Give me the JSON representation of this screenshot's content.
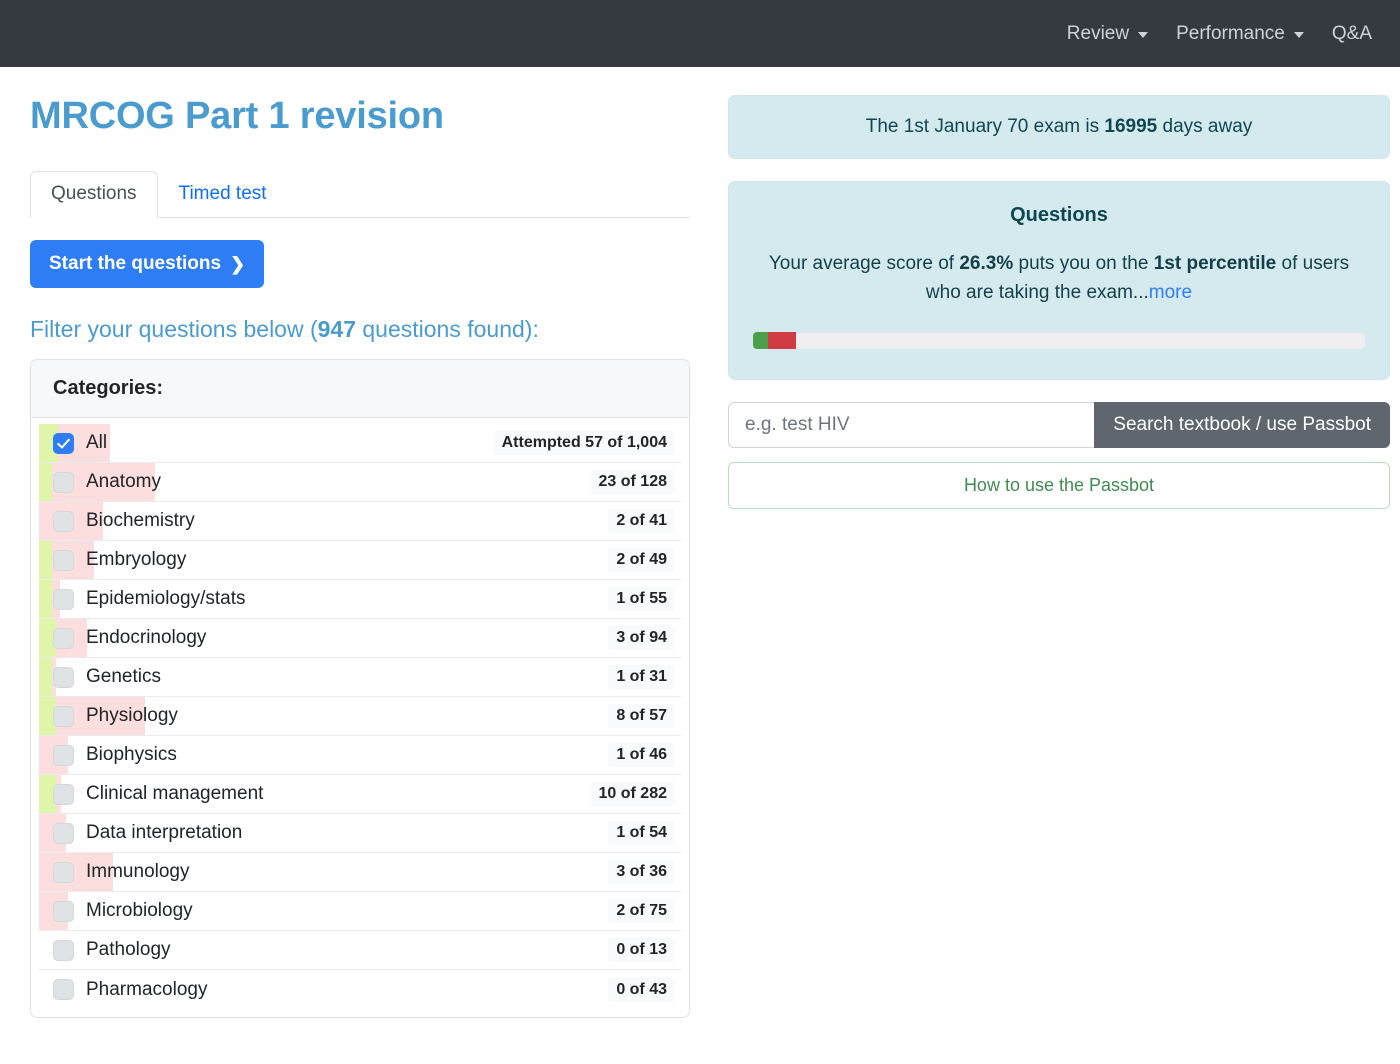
{
  "navbar": {
    "items": [
      {
        "label": "Review",
        "has_caret": true
      },
      {
        "label": "Performance",
        "has_caret": true
      },
      {
        "label": "Q&A",
        "has_caret": false
      }
    ]
  },
  "main": {
    "title": "MRCOG Part 1 revision",
    "tabs": [
      {
        "label": "Questions",
        "active": true
      },
      {
        "label": "Timed test",
        "active": false
      }
    ],
    "start_button": "Start the questions",
    "start_button_chevron": "❯",
    "filter_heading_prefix": "Filter your questions below (",
    "filter_heading_count": "947",
    "filter_heading_suffix": " questions found):",
    "categories_header": "Categories:",
    "categories": [
      {
        "label": "All",
        "count": "Attempted 57 of 1,004",
        "checked": true,
        "green_pct": 3,
        "red_pct": 11
      },
      {
        "label": "Anatomy",
        "count": "23 of 128",
        "checked": false,
        "green_pct": 2.1,
        "red_pct": 18
      },
      {
        "label": "Biochemistry",
        "count": "2 of 41",
        "checked": false,
        "green_pct": 0,
        "red_pct": 10
      },
      {
        "label": "Embryology",
        "count": "2 of 49",
        "checked": false,
        "green_pct": 2.1,
        "red_pct": 8.5
      },
      {
        "label": "Epidemiology/stats",
        "count": "1 of 55",
        "checked": false,
        "green_pct": 2.1,
        "red_pct": 3.2
      },
      {
        "label": "Endocrinology",
        "count": "3 of 94",
        "checked": false,
        "green_pct": 2.6,
        "red_pct": 7.5
      },
      {
        "label": "Genetics",
        "count": "1 of 31",
        "checked": false,
        "green_pct": 2.1,
        "red_pct": 2.6
      },
      {
        "label": "Physiology",
        "count": "8 of 57",
        "checked": false,
        "green_pct": 2.6,
        "red_pct": 16.5
      },
      {
        "label": "Biophysics",
        "count": "1 of 46",
        "checked": false,
        "green_pct": 0,
        "red_pct": 4.5
      },
      {
        "label": "Clinical management",
        "count": "10 of 282",
        "checked": false,
        "green_pct": 2.6,
        "red_pct": 3.4
      },
      {
        "label": "Data interpretation",
        "count": "1 of 54",
        "checked": false,
        "green_pct": 0,
        "red_pct": 4.2
      },
      {
        "label": "Immunology",
        "count": "3 of 36",
        "checked": false,
        "green_pct": 0,
        "red_pct": 11.5
      },
      {
        "label": "Microbiology",
        "count": "2 of 75",
        "checked": false,
        "green_pct": 0,
        "red_pct": 4.5
      },
      {
        "label": "Pathology",
        "count": "0 of 13",
        "checked": false,
        "green_pct": 0,
        "red_pct": 0
      },
      {
        "label": "Pharmacology",
        "count": "0 of 43",
        "checked": false,
        "green_pct": 0,
        "red_pct": 0
      }
    ]
  },
  "sidebar": {
    "exam_countdown": {
      "prefix": "The 1st January 70 exam is ",
      "days": "16995",
      "suffix": " days away"
    },
    "questions_panel": {
      "title": "Questions",
      "text_1": "Your average score of ",
      "score": "26.3%",
      "text_2": " puts you on the ",
      "percentile": "1st percentile",
      "text_3": " of users who are taking the exam...",
      "more_link": "more",
      "progress": {
        "green_pct": 2.4,
        "red_pct": 4.6
      }
    },
    "search": {
      "placeholder": "e.g. test HIV",
      "value": "",
      "button_label": "Search textbook / use Passbot"
    },
    "passbot_help_label": "How to use the Passbot"
  },
  "colors": {
    "navbar_bg": "#343a40",
    "accent_blue": "#4a9cd0",
    "primary_blue": "#2f7df4",
    "info_bg": "#d4eaef",
    "bar_green": "#d9f99d",
    "bar_red": "#fbdedd",
    "progress_green": "#4aa14a",
    "progress_red": "#cf3c43",
    "green_outline": "#3f8c52"
  }
}
